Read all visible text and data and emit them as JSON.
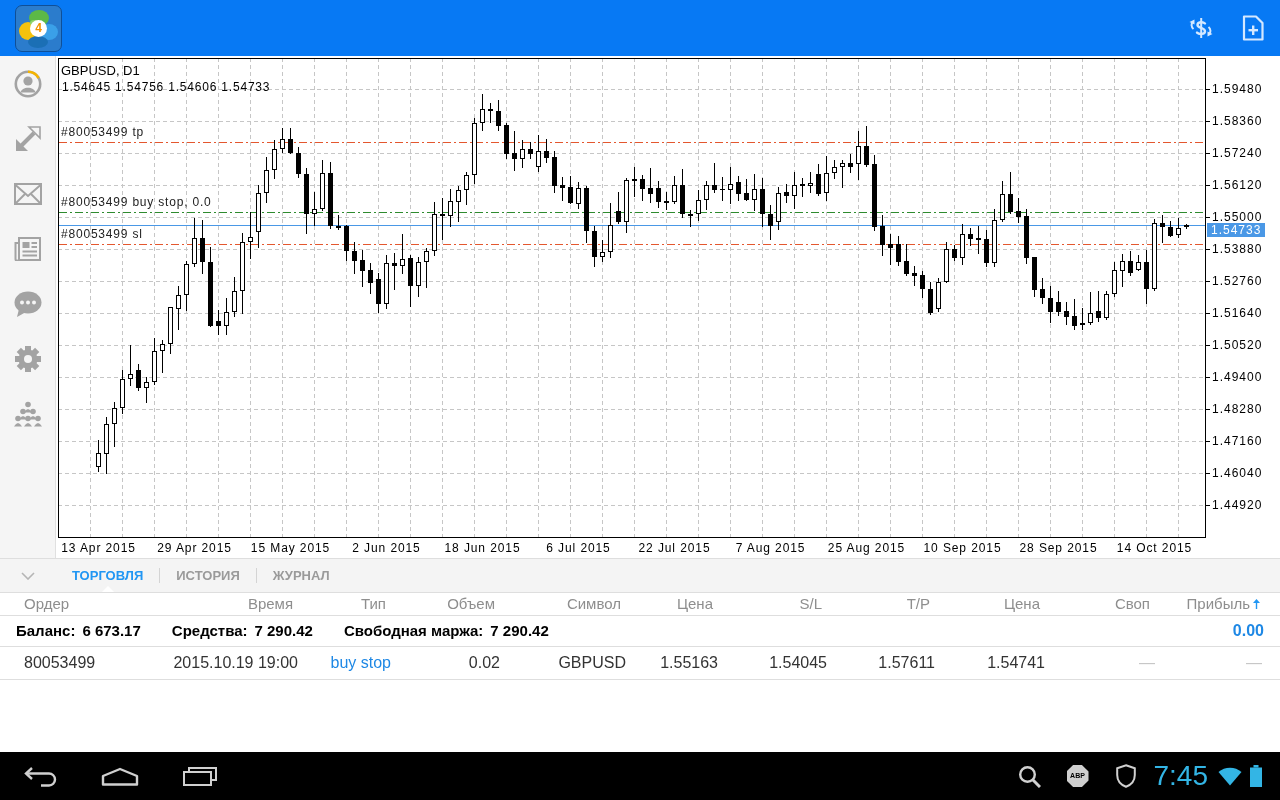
{
  "top_bar": {
    "logo_badge": "4"
  },
  "chart": {
    "chart_data": [
      {
        "type": "candlestick",
        "title": "GBPUSD, D1",
        "subtitle": "1.54645 1.54756 1.54606 1.54733",
        "categories": [
          "13 Apr 2015",
          null,
          null,
          null,
          null,
          null,
          null,
          null,
          null,
          null,
          null,
          null,
          "29 Apr 2015",
          null,
          null,
          null,
          null,
          null,
          null,
          null,
          null,
          null,
          null,
          null,
          "15 May 2015",
          null,
          null,
          null,
          null,
          null,
          null,
          null,
          null,
          null,
          null,
          null,
          "2 Jun 2015",
          null,
          null,
          null,
          null,
          null,
          null,
          null,
          null,
          null,
          null,
          null,
          "18 Jun 2015",
          null,
          null,
          null,
          null,
          null,
          null,
          null,
          null,
          null,
          null,
          null,
          "6 Jul 2015",
          null,
          null,
          null,
          null,
          null,
          null,
          null,
          null,
          null,
          null,
          null,
          "22 Jul 2015",
          null,
          null,
          null,
          null,
          null,
          null,
          null,
          null,
          null,
          null,
          null,
          "7 Aug 2015",
          null,
          null,
          null,
          null,
          null,
          null,
          null,
          null,
          null,
          null,
          null,
          "25 Aug 2015",
          null,
          null,
          null,
          null,
          null,
          null,
          null,
          null,
          null,
          null,
          null,
          "10 Sep 2015",
          null,
          null,
          null,
          null,
          null,
          null,
          null,
          null,
          null,
          null,
          null,
          "28 Sep 2015",
          null,
          null,
          null,
          null,
          null,
          null,
          null,
          null,
          null,
          null,
          null,
          "14 Oct 2015",
          null,
          null,
          null,
          null
        ],
        "ohlc": [
          [
            1.4625,
            1.472,
            1.461,
            1.4674
          ],
          [
            1.4669,
            1.4801,
            1.4603,
            1.4774
          ],
          [
            1.4774,
            1.4853,
            1.47,
            1.483
          ],
          [
            1.483,
            1.4964,
            1.4813,
            1.4932
          ],
          [
            1.4932,
            1.5052,
            1.4912,
            1.4949
          ],
          [
            1.4964,
            1.4985,
            1.4894,
            1.49
          ],
          [
            1.49,
            1.4941,
            1.4853,
            1.4921
          ],
          [
            1.4921,
            1.5078,
            1.4915,
            1.5031
          ],
          [
            1.5031,
            1.5069,
            1.4958,
            1.5054
          ],
          [
            1.5054,
            1.5186,
            1.5025,
            1.5184
          ],
          [
            1.5179,
            1.5259,
            1.5107,
            1.5226
          ],
          [
            1.5226,
            1.5346,
            1.5175,
            1.5335
          ],
          [
            1.5335,
            1.5495,
            1.5327,
            1.5425
          ],
          [
            1.5425,
            1.5489,
            1.5303,
            1.5341
          ],
          [
            1.5341,
            1.5394,
            1.5117,
            1.512
          ],
          [
            1.5135,
            1.5175,
            1.5089,
            1.512
          ],
          [
            1.512,
            1.5215,
            1.5089,
            1.5169
          ],
          [
            1.5169,
            1.5289,
            1.5154,
            1.5241
          ],
          [
            1.5241,
            1.5445,
            1.5163,
            1.5414
          ],
          [
            1.5414,
            1.5519,
            1.5355,
            1.5429
          ],
          [
            1.5449,
            1.5612,
            1.5396,
            1.5583
          ],
          [
            1.5583,
            1.5711,
            1.5554,
            1.5664
          ],
          [
            1.5664,
            1.5769,
            1.5635,
            1.5737
          ],
          [
            1.5737,
            1.581,
            1.5729,
            1.5772
          ],
          [
            1.5772,
            1.581,
            1.5723,
            1.5725
          ],
          [
            1.5723,
            1.5744,
            1.5641,
            1.5649
          ],
          [
            1.5649,
            1.567,
            1.5445,
            1.5509
          ],
          [
            1.5509,
            1.5589,
            1.5472,
            1.5527
          ],
          [
            1.5527,
            1.57,
            1.5525,
            1.5655
          ],
          [
            1.5655,
            1.5691,
            1.546,
            1.547
          ],
          [
            1.546,
            1.5507,
            1.5457,
            1.547
          ],
          [
            1.547,
            1.5472,
            1.535,
            1.538
          ],
          [
            1.5381,
            1.5414,
            1.5303,
            1.5347
          ],
          [
            1.535,
            1.5385,
            1.526,
            1.5312
          ],
          [
            1.5314,
            1.5338,
            1.5235,
            1.527
          ],
          [
            1.5283,
            1.5303,
            1.5169,
            1.5194
          ],
          [
            1.5194,
            1.5367,
            1.518,
            1.5338
          ],
          [
            1.5338,
            1.5375,
            1.5248,
            1.5327
          ],
          [
            1.5327,
            1.544,
            1.5303,
            1.5352
          ],
          [
            1.5355,
            1.5367,
            1.5189,
            1.526
          ],
          [
            1.526,
            1.5361,
            1.5223,
            1.5341
          ],
          [
            1.5341,
            1.5392,
            1.5256,
            1.538
          ],
          [
            1.538,
            1.5551,
            1.5367,
            1.5509
          ],
          [
            1.551,
            1.5565,
            1.5422,
            1.5504
          ],
          [
            1.5504,
            1.5597,
            1.5468,
            1.5557
          ],
          [
            1.5553,
            1.5608,
            1.5487,
            1.5594
          ],
          [
            1.5594,
            1.5656,
            1.5546,
            1.5647
          ],
          [
            1.5647,
            1.5845,
            1.562,
            1.5828
          ],
          [
            1.5828,
            1.5929,
            1.5804,
            1.5877
          ],
          [
            1.5877,
            1.5898,
            1.5834,
            1.5878
          ],
          [
            1.587,
            1.5909,
            1.5804,
            1.582
          ],
          [
            1.5822,
            1.5828,
            1.5705,
            1.5722
          ],
          [
            1.5723,
            1.5801,
            1.5664,
            1.5702
          ],
          [
            1.5702,
            1.5769,
            1.5676,
            1.5737
          ],
          [
            1.5737,
            1.5764,
            1.5708,
            1.5722
          ],
          [
            1.5675,
            1.5787,
            1.5662,
            1.573
          ],
          [
            1.5731,
            1.5772,
            1.5694,
            1.5708
          ],
          [
            1.5709,
            1.5731,
            1.5589,
            1.561
          ],
          [
            1.5612,
            1.5641,
            1.5559,
            1.5603
          ],
          [
            1.5604,
            1.5643,
            1.555,
            1.555
          ],
          [
            1.5544,
            1.5624,
            1.5533,
            1.56
          ],
          [
            1.56,
            1.5608,
            1.5414,
            1.5452
          ],
          [
            1.5452,
            1.5468,
            1.533,
            1.5361
          ],
          [
            1.5361,
            1.5421,
            1.5345,
            1.5376
          ],
          [
            1.5376,
            1.5548,
            1.5361,
            1.5472
          ],
          [
            1.5521,
            1.5589,
            1.5478,
            1.5484
          ],
          [
            1.5484,
            1.5635,
            1.5449,
            1.5628
          ],
          [
            1.5633,
            1.5676,
            1.5574,
            1.5627
          ],
          [
            1.5633,
            1.5647,
            1.5559,
            1.5598
          ],
          [
            1.56,
            1.5673,
            1.5554,
            1.5581
          ],
          [
            1.56,
            1.5627,
            1.5536,
            1.5554
          ],
          [
            1.5555,
            1.5586,
            1.5528,
            1.5556
          ],
          [
            1.5554,
            1.5645,
            1.5548,
            1.5611
          ],
          [
            1.5611,
            1.5669,
            1.5501,
            1.5511
          ],
          [
            1.5512,
            1.5525,
            1.5468,
            1.5504
          ],
          [
            1.5509,
            1.5594,
            1.5491,
            1.5558
          ],
          [
            1.5558,
            1.5627,
            1.5529,
            1.5611
          ],
          [
            1.5611,
            1.5688,
            1.5589,
            1.5596
          ],
          [
            1.5598,
            1.5641,
            1.5561,
            1.5593
          ],
          [
            1.5593,
            1.5675,
            1.555,
            1.5614
          ],
          [
            1.5621,
            1.5645,
            1.5561,
            1.5581
          ],
          [
            1.5583,
            1.5633,
            1.5559,
            1.5561
          ],
          [
            1.5561,
            1.5651,
            1.5525,
            1.5597
          ],
          [
            1.5598,
            1.5636,
            1.5468,
            1.5511
          ],
          [
            1.5512,
            1.5541,
            1.5424,
            1.5468
          ],
          [
            1.5484,
            1.5605,
            1.5458,
            1.5583
          ],
          [
            1.5589,
            1.5615,
            1.5552,
            1.5572
          ],
          [
            1.5572,
            1.5656,
            1.5533,
            1.5611
          ],
          [
            1.5614,
            1.5636,
            1.5574,
            1.561
          ],
          [
            1.561,
            1.5656,
            1.5589,
            1.5618
          ],
          [
            1.5649,
            1.5685,
            1.5577,
            1.558
          ],
          [
            1.5583,
            1.5713,
            1.5559,
            1.5655
          ],
          [
            1.5655,
            1.57,
            1.5635,
            1.5676
          ],
          [
            1.5676,
            1.57,
            1.5606,
            1.5688
          ],
          [
            1.5688,
            1.572,
            1.5659,
            1.5676
          ],
          [
            1.5684,
            1.5801,
            1.5632,
            1.5747
          ],
          [
            1.5747,
            1.5817,
            1.568,
            1.5683
          ],
          [
            1.5684,
            1.5716,
            1.5454,
            1.5465
          ],
          [
            1.547,
            1.5507,
            1.5367,
            1.5403
          ],
          [
            1.5406,
            1.544,
            1.5334,
            1.539
          ],
          [
            1.5406,
            1.5433,
            1.5332,
            1.5342
          ],
          [
            1.5345,
            1.5406,
            1.5297,
            1.5302
          ],
          [
            1.5303,
            1.5327,
            1.5262,
            1.5295
          ],
          [
            1.5296,
            1.5312,
            1.5219,
            1.5248
          ],
          [
            1.5248,
            1.5274,
            1.516,
            1.5163
          ],
          [
            1.5177,
            1.5285,
            1.5172,
            1.5271
          ],
          [
            1.5271,
            1.5414,
            1.5271,
            1.5387
          ],
          [
            1.5387,
            1.5402,
            1.535,
            1.5358
          ],
          [
            1.5358,
            1.5475,
            1.5335,
            1.544
          ],
          [
            1.544,
            1.546,
            1.5402,
            1.5424
          ],
          [
            1.5425,
            1.547,
            1.5373,
            1.542
          ],
          [
            1.5423,
            1.5454,
            1.533,
            1.5338
          ],
          [
            1.5338,
            1.5528,
            1.533,
            1.5488
          ],
          [
            1.5488,
            1.5627,
            1.5487,
            1.5579
          ],
          [
            1.5579,
            1.5657,
            1.5515,
            1.5519
          ],
          [
            1.5521,
            1.5568,
            1.5481,
            1.5501
          ],
          [
            1.5503,
            1.5528,
            1.5338,
            1.5355
          ],
          [
            1.5359,
            1.5361,
            1.5223,
            1.5246
          ],
          [
            1.5248,
            1.5285,
            1.52,
            1.5215
          ],
          [
            1.5216,
            1.5259,
            1.5134,
            1.5166
          ],
          [
            1.5201,
            1.5242,
            1.5157,
            1.5169
          ],
          [
            1.5171,
            1.5204,
            1.5127,
            1.5151
          ],
          [
            1.5153,
            1.5213,
            1.5107,
            1.5119
          ],
          [
            1.5121,
            1.518,
            1.5107,
            1.5128
          ],
          [
            1.5128,
            1.5237,
            1.5125,
            1.5163
          ],
          [
            1.5171,
            1.5242,
            1.5137,
            1.5145
          ],
          [
            1.5145,
            1.5242,
            1.5142,
            1.5231
          ],
          [
            1.5229,
            1.5341,
            1.5225,
            1.5313
          ],
          [
            1.5312,
            1.537,
            1.526,
            1.5346
          ],
          [
            1.5346,
            1.5381,
            1.5297,
            1.5303
          ],
          [
            1.5315,
            1.5368,
            1.5313,
            1.5341
          ],
          [
            1.5341,
            1.5383,
            1.52,
            1.5248
          ],
          [
            1.5248,
            1.5492,
            1.5246,
            1.5478
          ],
          [
            1.5478,
            1.5507,
            1.5414,
            1.5464
          ],
          [
            1.5465,
            1.5485,
            1.5433,
            1.5433
          ],
          [
            1.5436,
            1.5498,
            1.5429,
            1.546
          ],
          [
            1.54645,
            1.54756,
            1.54606,
            1.54733
          ]
        ],
        "ylim": [
          1.438,
          1.60565
        ],
        "yticks": [
          {
            "value": 1.5948,
            "label": "1.59480"
          },
          {
            "value": 1.5836,
            "label": "1.58360"
          },
          {
            "value": 1.5724,
            "label": "1.57240"
          },
          {
            "value": 1.5612,
            "label": "1.56120"
          },
          {
            "value": 1.55,
            "label": "1.55000"
          },
          {
            "value": 1.5388,
            "label": "1.53880"
          },
          {
            "value": 1.5276,
            "label": "1.52760"
          },
          {
            "value": 1.5164,
            "label": "1.51640"
          },
          {
            "value": 1.5052,
            "label": "1.50520"
          },
          {
            "value": 1.494,
            "label": "1.49400"
          },
          {
            "value": 1.4828,
            "label": "1.48280"
          },
          {
            "value": 1.4716,
            "label": "1.47160"
          },
          {
            "value": 1.4604,
            "label": "1.46040"
          },
          {
            "value": 1.4492,
            "label": "1.44920"
          }
        ],
        "grid": true,
        "ref_lines": [
          {
            "axis": "y",
            "value": 1.57611,
            "label": "#80053499 tp",
            "color": "#e4572e",
            "line_style": "dashdot"
          },
          {
            "axis": "y",
            "value": 1.55163,
            "label": "#80053499 buy stop, 0.0",
            "color": "#2e8b2e",
            "line_style": "dashdot"
          },
          {
            "axis": "y",
            "value": 1.54733,
            "label": "1.54733",
            "color": "#4a98e6",
            "line_style": "solid"
          },
          {
            "axis": "y",
            "value": 1.54045,
            "label": "#80053499 sl",
            "color": "#e4572e",
            "line_style": "dashdot"
          }
        ]
      }
    ]
  },
  "bottom_panel": {
    "tabs": [
      {
        "label": "ТОРГОВЛЯ",
        "selected": true
      },
      {
        "label": "ИСТОРИЯ",
        "selected": false
      },
      {
        "label": "ЖУРНАЛ",
        "selected": false
      }
    ],
    "table": {
      "columns": [
        {
          "label": "Ордер",
          "sorted": false
        },
        {
          "label": "Время",
          "sorted": false
        },
        {
          "label": "Тип",
          "sorted": false
        },
        {
          "label": "Объем",
          "sorted": false
        },
        {
          "label": "Символ",
          "sorted": false
        },
        {
          "label": "Цена",
          "sorted": false
        },
        {
          "label": "S/L",
          "sorted": false
        },
        {
          "label": "T/P",
          "sorted": false
        },
        {
          "label": "Цена",
          "sorted": false
        },
        {
          "label": "Своп",
          "sorted": false
        },
        {
          "label": "Прибыль",
          "sorted": true
        }
      ],
      "summary": {
        "items": [
          {
            "label": "Баланс:",
            "value": "6 673.17"
          },
          {
            "label": "Средства:",
            "value": "7 290.42"
          },
          {
            "label": "Свободная маржа:",
            "value": "7 290.42"
          }
        ],
        "profit": "0.00"
      },
      "rows": [
        {
          "cells": [
            {
              "kind": "text",
              "text": "80053499"
            },
            {
              "kind": "text",
              "text": "2015.10.19 19:00"
            },
            {
              "kind": "link",
              "text": "buy stop"
            },
            {
              "kind": "text",
              "text": "0.02"
            },
            {
              "kind": "text",
              "text": "GBPUSD"
            },
            {
              "kind": "text",
              "text": "1.55163"
            },
            {
              "kind": "text",
              "text": "1.54045"
            },
            {
              "kind": "text",
              "text": "1.57611"
            },
            {
              "kind": "text",
              "text": "1.54741"
            },
            {
              "kind": "empty",
              "text": "—"
            },
            {
              "kind": "empty",
              "text": "—"
            }
          ]
        }
      ]
    }
  },
  "system_bar": {
    "adblock_label": "ABP",
    "clock": "7:45"
  }
}
